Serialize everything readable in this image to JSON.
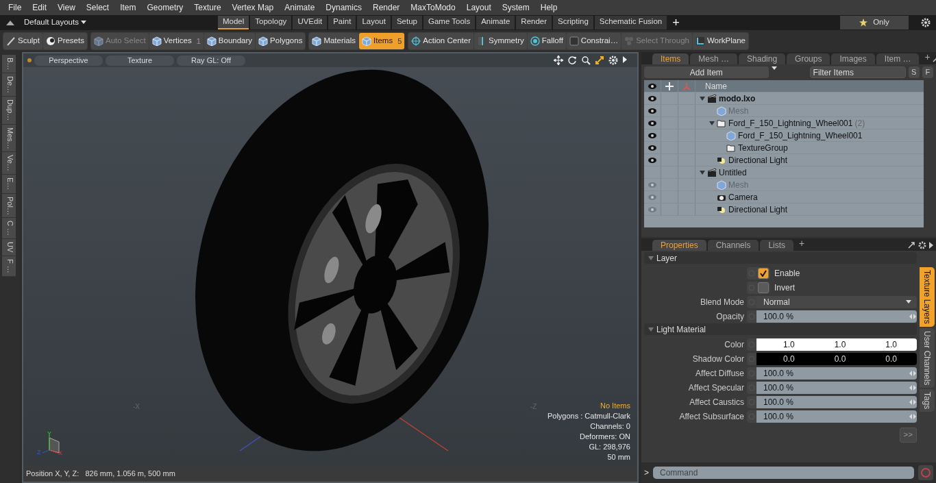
{
  "menu": [
    "File",
    "Edit",
    "View",
    "Select",
    "Item",
    "Geometry",
    "Texture",
    "Vertex Map",
    "Animate",
    "Dynamics",
    "Render",
    "MaxToModo",
    "Layout",
    "System",
    "Help"
  ],
  "layout_bar": {
    "layouts": "Default Layouts",
    "tabs": [
      {
        "label": "Model",
        "selected": true
      },
      {
        "label": "Topology",
        "selected": false
      },
      {
        "label": "UVEdit",
        "selected": false
      },
      {
        "label": "Paint",
        "selected": false
      },
      {
        "label": "Layout",
        "selected": false
      },
      {
        "label": "Setup",
        "selected": false
      },
      {
        "label": "Game Tools",
        "selected": false
      },
      {
        "label": "Animate",
        "selected": false
      },
      {
        "label": "Render",
        "selected": false
      },
      {
        "label": "Scripting",
        "selected": false
      },
      {
        "label": "Schematic Fusion",
        "selected": false
      }
    ],
    "add_tab": "+",
    "favorites": "Only"
  },
  "toolbar": [
    [
      {
        "label": "Sculpt",
        "selected": false,
        "disabled": false
      },
      {
        "label": "Presets",
        "selected": false,
        "disabled": false
      }
    ],
    [
      {
        "label": "Auto Select",
        "selected": false,
        "disabled": true
      },
      {
        "label": "Vertices",
        "count": "1",
        "selected": false,
        "disabled": false
      },
      {
        "label": "Boundary",
        "selected": false,
        "disabled": false
      },
      {
        "label": "Polygons",
        "selected": false,
        "disabled": false
      }
    ],
    [
      {
        "label": "Materials",
        "selected": false,
        "disabled": false
      },
      {
        "label": "Items",
        "count": "5",
        "selected": true,
        "disabled": false
      }
    ],
    [
      {
        "label": "Action Center",
        "selected": false,
        "disabled": false
      },
      {
        "label": "Symmetry",
        "selected": false,
        "disabled": false
      },
      {
        "label": "Falloff",
        "selected": false,
        "disabled": false
      },
      {
        "label": "Constrai…",
        "selected": false,
        "disabled": false
      },
      {
        "label": "Select Through",
        "selected": false,
        "disabled": true
      },
      {
        "label": "WorkPlane",
        "selected": false,
        "disabled": false
      }
    ]
  ],
  "left_tabs": [
    "B…",
    "De…",
    "Dup…",
    "Mes…",
    "Ve…",
    "E…",
    "Pol…",
    "C …",
    "UV",
    "F …"
  ],
  "viewport": {
    "buttons": [
      "Perspective",
      "Texture",
      "Ray GL: Off"
    ],
    "axis_labels": [
      "-X",
      "-Z"
    ],
    "gizmo_labels": [
      "Y",
      "Z",
      "X"
    ],
    "info": [
      {
        "text": "No Items",
        "kind": "notice"
      },
      {
        "text": "Polygons : Catmull-Clark",
        "kind": "stat"
      },
      {
        "text": "Channels: 0",
        "kind": "stat"
      },
      {
        "text": "Deformers: ON",
        "kind": "stat"
      },
      {
        "text": "GL: 298,976",
        "kind": "stat"
      },
      {
        "text": "50 mm",
        "kind": "stat"
      }
    ],
    "status": "Position X, Y, Z:   826 mm, 1.056 m, 500 mm"
  },
  "items_panel": {
    "tabs": [
      {
        "label": "Items",
        "selected": true
      },
      {
        "label": "Mesh …",
        "selected": false
      },
      {
        "label": "Shading",
        "selected": false
      },
      {
        "label": "Groups",
        "selected": false
      },
      {
        "label": "Images",
        "selected": false
      },
      {
        "label": "Item …",
        "selected": false
      }
    ],
    "add_tab": "+",
    "add_item": "Add Item",
    "filter_placeholder": "Filter Items",
    "filter_buttons": [
      "S",
      "F"
    ],
    "name_column": "Name",
    "tree": [
      {
        "name": "modo.lxo",
        "kind": "scene",
        "visible": true,
        "bold": true,
        "expanded": true,
        "children": [
          {
            "name": "Mesh",
            "kind": "mesh",
            "visible": true,
            "dim": true
          },
          {
            "name": "Ford_F_150_Lightning_Wheel001",
            "count": "(2)",
            "kind": "group",
            "visible": true,
            "expanded": true,
            "children": [
              {
                "name": "Ford_F_150_Lightning_Wheel001",
                "kind": "mesh",
                "visible": true
              },
              {
                "name": "TextureGroup",
                "kind": "group",
                "visible": true
              }
            ]
          },
          {
            "name": "Directional Light",
            "kind": "light",
            "visible": true
          }
        ]
      },
      {
        "name": "Untitled",
        "kind": "scene",
        "expanded": true,
        "children": [
          {
            "name": "Mesh",
            "kind": "mesh",
            "visible": false,
            "dim": true
          },
          {
            "name": "Camera",
            "kind": "camera",
            "visible": false
          },
          {
            "name": "Directional Light",
            "kind": "light",
            "visible": false
          }
        ]
      }
    ]
  },
  "properties": {
    "tabs": [
      {
        "label": "Properties",
        "selected": true
      },
      {
        "label": "Channels",
        "selected": false
      },
      {
        "label": "Lists",
        "selected": false
      }
    ],
    "add_tab": "+",
    "sections": [
      {
        "title": "Layer",
        "rows": [
          {
            "kind": "checkbox",
            "label": "Enable",
            "checked": true
          },
          {
            "kind": "checkbox",
            "label": "Invert",
            "checked": false
          },
          {
            "kind": "dropdown",
            "label": "Blend Mode",
            "value": "Normal"
          },
          {
            "kind": "percent",
            "label": "Opacity",
            "value": "100.0 %"
          }
        ]
      },
      {
        "title": "Light Material",
        "rows": [
          {
            "kind": "color",
            "label": "Color",
            "values": [
              "1.0",
              "1.0",
              "1.0"
            ],
            "color": "#ffffff"
          },
          {
            "kind": "color",
            "label": "Shadow Color",
            "values": [
              "0.0",
              "0.0",
              "0.0"
            ],
            "color": "#000000"
          },
          {
            "kind": "percent",
            "label": "Affect Diffuse",
            "value": "100.0 %"
          },
          {
            "kind": "percent",
            "label": "Affect Specular",
            "value": "100.0 %"
          },
          {
            "kind": "percent",
            "label": "Affect Caustics",
            "value": "100.0 %"
          },
          {
            "kind": "percent",
            "label": "Affect Subsurface",
            "value": "100.0 %"
          }
        ]
      }
    ],
    "side_tabs": [
      {
        "label": "Texture Layers",
        "selected": true
      },
      {
        "label": "User Channels",
        "selected": false
      },
      {
        "label": "Tags",
        "selected": false
      }
    ],
    "more": ">>"
  },
  "command": {
    "prompt": ">",
    "placeholder": "Command"
  }
}
